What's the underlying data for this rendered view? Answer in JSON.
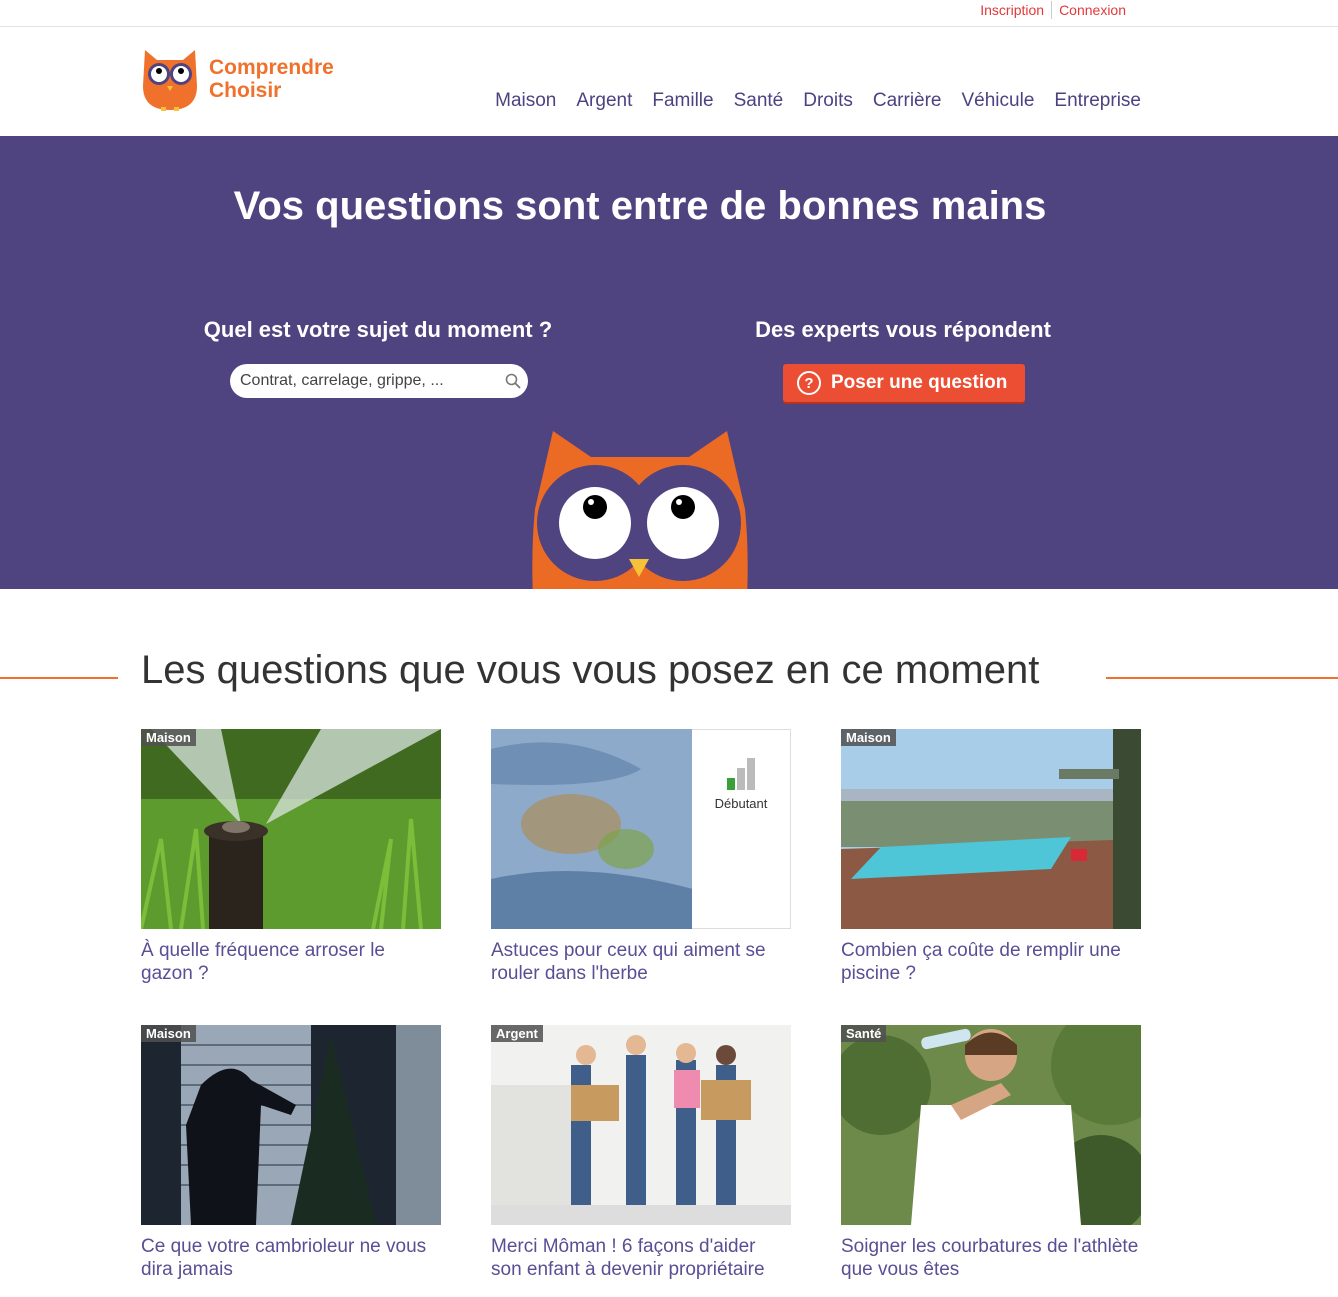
{
  "top_links": [
    "Inscription",
    "Connexion"
  ],
  "brand": {
    "line1": "Comprendre",
    "line2": "Choisir"
  },
  "nav": [
    "Maison",
    "Argent",
    "Famille",
    "Santé",
    "Droits",
    "Carrière",
    "Véhicule",
    "Entreprise"
  ],
  "hero": {
    "title": "Vos questions sont entre de bonnes mains",
    "left_heading": "Quel est votre sujet du moment ?",
    "search_placeholder": "Contrat, carrelage, grippe, ...",
    "right_heading": "Des experts vous répondent",
    "ask_button": "Poser une question"
  },
  "section_title": "Les questions que vous vous posez en ce moment",
  "cards": [
    {
      "tag": "Maison",
      "title": "À quelle fréquence arroser le gazon ?",
      "image": "lawn-sprinkler"
    },
    {
      "tag": "",
      "title": "Astuces pour ceux qui aiment se rouler dans l'herbe",
      "image": "grass-stain-jeans",
      "level": "Débutant"
    },
    {
      "tag": "Maison",
      "title": "Combien ça coûte de remplir une piscine ?",
      "image": "infinity-pool"
    },
    {
      "tag": "Maison",
      "title": "Ce que votre cambrioleur ne vous dira jamais",
      "image": "burglar-silhouette"
    },
    {
      "tag": "Argent",
      "title": "Merci Môman ! 6 façons d'aider son enfant à devenir propriétaire",
      "image": "moving-boxes-people"
    },
    {
      "tag": "Santé",
      "title": "Soigner les courbatures de l'athlète que vous êtes",
      "image": "woman-drinking-water"
    }
  ],
  "colors": {
    "brand_orange": "#f0712c",
    "hero_purple": "#4f4480",
    "nav_purple": "#4b4381",
    "cta_red": "#ec4e33"
  }
}
